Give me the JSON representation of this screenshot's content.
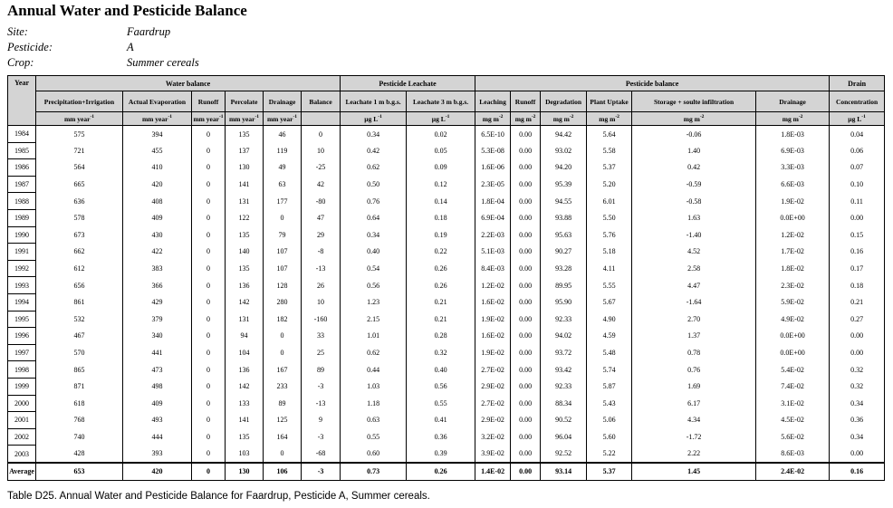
{
  "title": "Annual Water and Pesticide Balance",
  "meta": [
    {
      "key": "Site:",
      "value": "Faardrup"
    },
    {
      "key": "Pesticide:",
      "value": "A"
    },
    {
      "key": "Crop:",
      "value": "Summer cereals"
    }
  ],
  "table": {
    "groups": {
      "year": "Year",
      "water_balance": "Water balance",
      "pesticide_leachate": "Pesticide Leachate",
      "pesticide_balance": "Pesticide balance",
      "drain": "Drain"
    },
    "headers": [
      "Precipitation+Irrigation",
      "Actual Evaporation",
      "Runoff",
      "Percolate",
      "Drainage",
      "Balance",
      "Leachate 1 m b.g.s.",
      "Leachate 3 m b.g.s.",
      "Leaching",
      "Runoff",
      "Degradation",
      "Plant Uptake",
      "Storage + soulte infiltration",
      "Drainage",
      "Concentration"
    ],
    "units": [
      "mm year",
      "mm year",
      "mm year",
      "mm year",
      "mm year",
      "",
      "µg L",
      "µg L",
      "mg m",
      "mg m",
      "mg m",
      "mg m",
      "mg m",
      "mg m",
      "µg L"
    ],
    "unit_sups": [
      "-1",
      "-1",
      "-1",
      "-1",
      "-1",
      "",
      "-1",
      "-1",
      "-2",
      "-2",
      "-2",
      "-2",
      "-2",
      "-2",
      "-1"
    ],
    "rows": [
      [
        "1984",
        "575",
        "394",
        "0",
        "135",
        "46",
        "0",
        "0.34",
        "0.02",
        "6.5E-10",
        "0.00",
        "94.42",
        "5.64",
        "-0.06",
        "1.8E-03",
        "0.04"
      ],
      [
        "1985",
        "721",
        "455",
        "0",
        "137",
        "119",
        "10",
        "0.42",
        "0.05",
        "5.3E-08",
        "0.00",
        "93.02",
        "5.58",
        "1.40",
        "6.9E-03",
        "0.06"
      ],
      [
        "1986",
        "564",
        "410",
        "0",
        "130",
        "49",
        "-25",
        "0.62",
        "0.09",
        "1.6E-06",
        "0.00",
        "94.20",
        "5.37",
        "0.42",
        "3.3E-03",
        "0.07"
      ],
      [
        "1987",
        "665",
        "420",
        "0",
        "141",
        "63",
        "42",
        "0.50",
        "0.12",
        "2.3E-05",
        "0.00",
        "95.39",
        "5.20",
        "-0.59",
        "6.6E-03",
        "0.10"
      ],
      [
        "1988",
        "636",
        "408",
        "0",
        "131",
        "177",
        "-80",
        "0.76",
        "0.14",
        "1.8E-04",
        "0.00",
        "94.55",
        "6.01",
        "-0.58",
        "1.9E-02",
        "0.11"
      ],
      [
        "1989",
        "578",
        "409",
        "0",
        "122",
        "0",
        "47",
        "0.64",
        "0.18",
        "6.9E-04",
        "0.00",
        "93.88",
        "5.50",
        "1.63",
        "0.0E+00",
        "0.00"
      ],
      [
        "1990",
        "673",
        "430",
        "0",
        "135",
        "79",
        "29",
        "0.34",
        "0.19",
        "2.2E-03",
        "0.00",
        "95.63",
        "5.76",
        "-1.40",
        "1.2E-02",
        "0.15"
      ],
      [
        "1991",
        "662",
        "422",
        "0",
        "140",
        "107",
        "-8",
        "0.40",
        "0.22",
        "5.1E-03",
        "0.00",
        "90.27",
        "5.18",
        "4.52",
        "1.7E-02",
        "0.16"
      ],
      [
        "1992",
        "612",
        "383",
        "0",
        "135",
        "107",
        "-13",
        "0.54",
        "0.26",
        "8.4E-03",
        "0.00",
        "93.28",
        "4.11",
        "2.58",
        "1.8E-02",
        "0.17"
      ],
      [
        "1993",
        "656",
        "366",
        "0",
        "136",
        "128",
        "26",
        "0.56",
        "0.26",
        "1.2E-02",
        "0.00",
        "89.95",
        "5.55",
        "4.47",
        "2.3E-02",
        "0.18"
      ],
      [
        "1994",
        "861",
        "429",
        "0",
        "142",
        "280",
        "10",
        "1.23",
        "0.21",
        "1.6E-02",
        "0.00",
        "95.90",
        "5.67",
        "-1.64",
        "5.9E-02",
        "0.21"
      ],
      [
        "1995",
        "532",
        "379",
        "0",
        "131",
        "182",
        "-160",
        "2.15",
        "0.21",
        "1.9E-02",
        "0.00",
        "92.33",
        "4.90",
        "2.70",
        "4.9E-02",
        "0.27"
      ],
      [
        "1996",
        "467",
        "340",
        "0",
        "94",
        "0",
        "33",
        "1.01",
        "0.28",
        "1.6E-02",
        "0.00",
        "94.02",
        "4.59",
        "1.37",
        "0.0E+00",
        "0.00"
      ],
      [
        "1997",
        "570",
        "441",
        "0",
        "104",
        "0",
        "25",
        "0.62",
        "0.32",
        "1.9E-02",
        "0.00",
        "93.72",
        "5.48",
        "0.78",
        "0.0E+00",
        "0.00"
      ],
      [
        "1998",
        "865",
        "473",
        "0",
        "136",
        "167",
        "89",
        "0.44",
        "0.40",
        "2.7E-02",
        "0.00",
        "93.42",
        "5.74",
        "0.76",
        "5.4E-02",
        "0.32"
      ],
      [
        "1999",
        "871",
        "498",
        "0",
        "142",
        "233",
        "-3",
        "1.03",
        "0.56",
        "2.9E-02",
        "0.00",
        "92.33",
        "5.87",
        "1.69",
        "7.4E-02",
        "0.32"
      ],
      [
        "2000",
        "618",
        "409",
        "0",
        "133",
        "89",
        "-13",
        "1.18",
        "0.55",
        "2.7E-02",
        "0.00",
        "88.34",
        "5.43",
        "6.17",
        "3.1E-02",
        "0.34"
      ],
      [
        "2001",
        "768",
        "493",
        "0",
        "141",
        "125",
        "9",
        "0.63",
        "0.41",
        "2.9E-02",
        "0.00",
        "90.52",
        "5.06",
        "4.34",
        "4.5E-02",
        "0.36"
      ],
      [
        "2002",
        "740",
        "444",
        "0",
        "135",
        "164",
        "-3",
        "0.55",
        "0.36",
        "3.2E-02",
        "0.00",
        "96.04",
        "5.60",
        "-1.72",
        "5.6E-02",
        "0.34"
      ],
      [
        "2003",
        "428",
        "393",
        "0",
        "103",
        "0",
        "-68",
        "0.60",
        "0.39",
        "3.9E-02",
        "0.00",
        "92.52",
        "5.22",
        "2.22",
        "8.6E-03",
        "0.00"
      ]
    ],
    "average": [
      "Average",
      "653",
      "420",
      "0",
      "130",
      "106",
      "-3",
      "0.73",
      "0.26",
      "1.4E-02",
      "0.00",
      "93.14",
      "5.37",
      "1.45",
      "2.4E-02",
      "0.16"
    ]
  },
  "caption": "Table D25. Annual Water and Pesticide Balance for Faardrup, Pesticide A, Summer cereals."
}
